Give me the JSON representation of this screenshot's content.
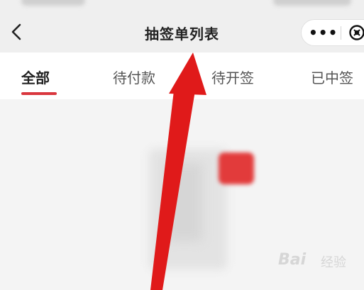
{
  "navbar": {
    "title": "抽签单列表",
    "more_label": "•••"
  },
  "tabs": [
    {
      "label": "全部",
      "active": true
    },
    {
      "label": "待付款",
      "active": false
    },
    {
      "label": "待开签",
      "active": false
    },
    {
      "label": "已中签",
      "active": false
    }
  ],
  "icons": {
    "back": "chevron-left-icon",
    "close": "close-circle-icon"
  },
  "watermark": {
    "logo": "Bai",
    "text": "经验"
  },
  "colors": {
    "accent": "#d9373e",
    "annotation_arrow": "#e01a1a"
  }
}
